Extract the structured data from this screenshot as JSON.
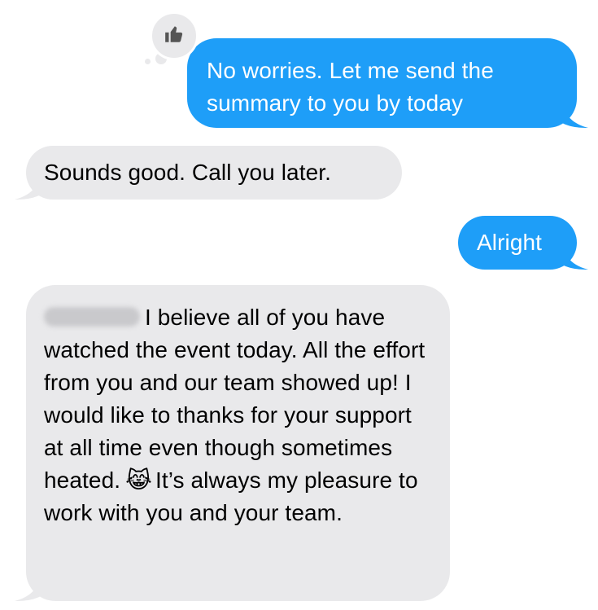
{
  "messages": [
    {
      "direction": "sent",
      "text": "No worries. Let me send the summary to you by today"
    },
    {
      "direction": "received",
      "text": "Sounds good. Call you later."
    },
    {
      "direction": "sent",
      "text": "Alright"
    },
    {
      "direction": "received",
      "text_part1": "I believe all of you have watched the event today. All the effort from you and our team showed up! I would like to thanks for your support at all time even though sometimes heated.",
      "emoji": "😹",
      "text_part2": "It’s always my pleasure to work with you and your team."
    }
  ],
  "tapback": {
    "icon": "thumbs-up-icon"
  },
  "colors": {
    "sent_bubble": "#1e9ef8",
    "received_bubble": "#e9e9eb",
    "tapback_icon": "#555555"
  }
}
